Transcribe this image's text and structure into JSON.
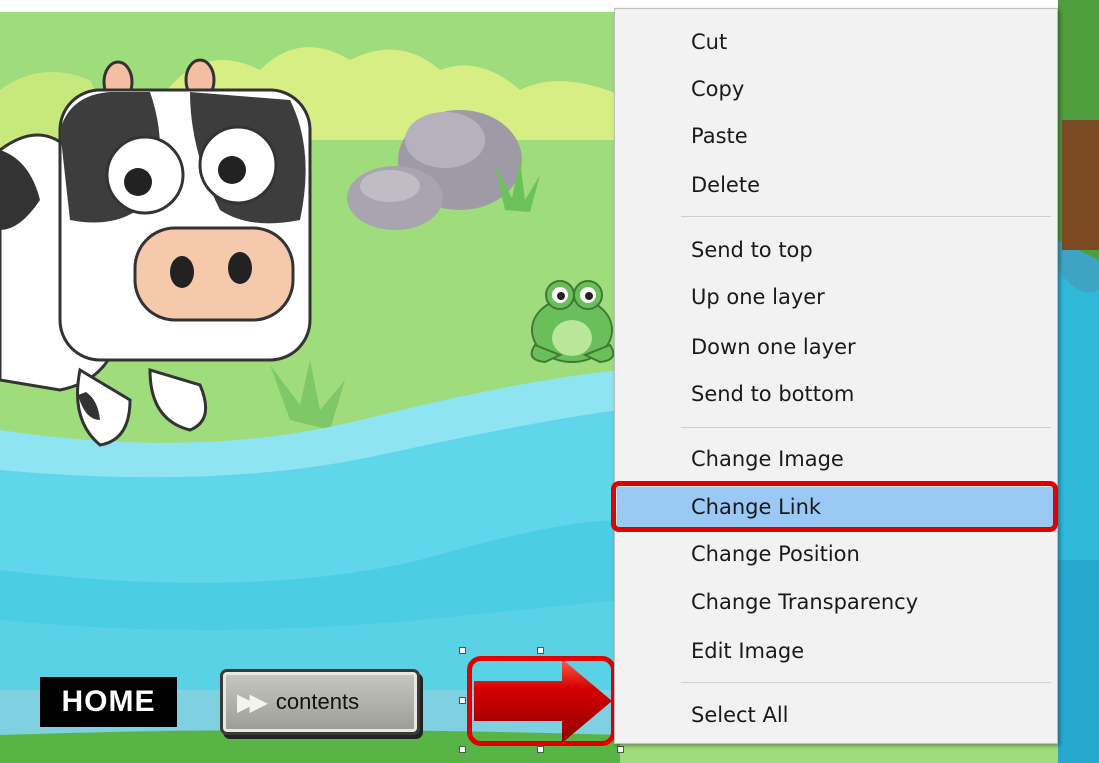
{
  "nav": {
    "home_label": "HOME",
    "contents_label": "contents",
    "contents_icon": "fast-forward-icon",
    "next_icon": "right-arrow-icon"
  },
  "context_menu": {
    "items": [
      {
        "label": "Cut"
      },
      {
        "label": "Copy"
      },
      {
        "label": "Paste"
      },
      {
        "label": "Delete"
      },
      {
        "label": "Send to top"
      },
      {
        "label": "Up one layer"
      },
      {
        "label": "Down one layer"
      },
      {
        "label": "Send to bottom"
      },
      {
        "label": "Change Image"
      },
      {
        "label": "Change Link"
      },
      {
        "label": "Change Position"
      },
      {
        "label": "Change Transparency"
      },
      {
        "label": "Edit Image"
      },
      {
        "label": "Select All"
      }
    ],
    "highlighted_item": "Change Link"
  },
  "colors": {
    "highlight_outline": "#e00000",
    "menu_hover": "#99c9f4",
    "arrow_fill": "#c40000"
  }
}
